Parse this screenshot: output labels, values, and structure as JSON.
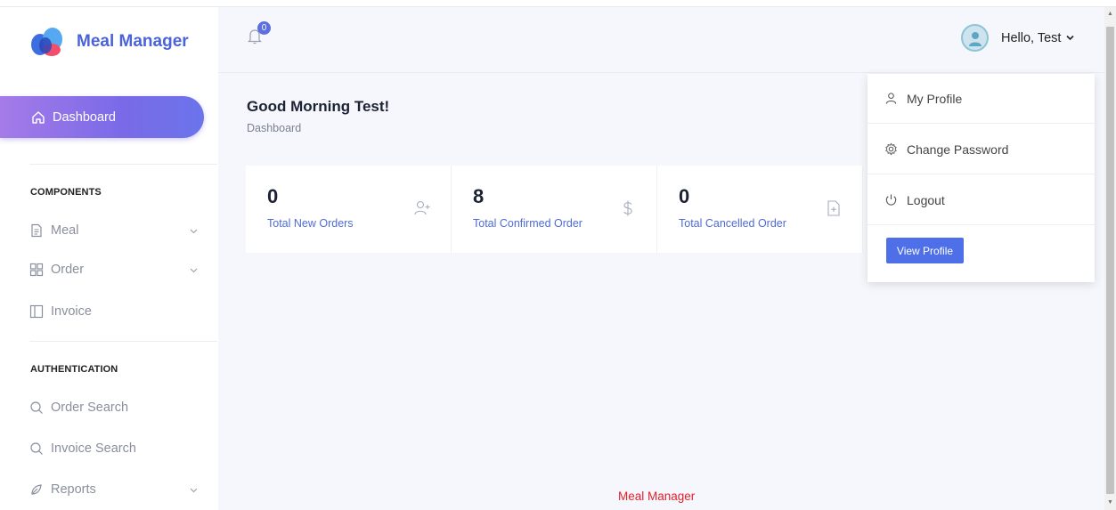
{
  "app": {
    "name": "Meal Manager"
  },
  "sidebar": {
    "active_item": "Dashboard",
    "section_components": "COMPONENTS",
    "components": [
      {
        "label": "Meal",
        "icon": "document-icon",
        "expandable": true
      },
      {
        "label": "Order",
        "icon": "grid-icon",
        "expandable": true
      },
      {
        "label": "Invoice",
        "icon": "panel-icon",
        "expandable": false
      }
    ],
    "section_auth": "AUTHENTICATION",
    "auth": [
      {
        "label": "Order Search",
        "icon": "search-icon",
        "expandable": false
      },
      {
        "label": "Invoice Search",
        "icon": "search-icon",
        "expandable": false
      },
      {
        "label": "Reports",
        "icon": "pen-icon",
        "expandable": true
      }
    ]
  },
  "header": {
    "notification_count": "0",
    "user_greeting": "Hello, Test"
  },
  "page": {
    "greeting": "Good Morning Test!",
    "breadcrumb": "Dashboard"
  },
  "stats": [
    {
      "value": "0",
      "label": "Total New Orders",
      "icon": "add-user-icon"
    },
    {
      "value": "8",
      "label": "Total Confirmed Order",
      "icon": "dollar-icon"
    },
    {
      "value": "0",
      "label": "Total Cancelled Order",
      "icon": "file-plus-icon"
    }
  ],
  "dropdown": {
    "items": [
      {
        "label": "My Profile",
        "icon": "user-icon"
      },
      {
        "label": "Change Password",
        "icon": "gear-icon"
      },
      {
        "label": "Logout",
        "icon": "power-icon"
      }
    ],
    "button": "View Profile"
  },
  "footer": {
    "text": "Meal Manager"
  },
  "colors": {
    "accent": "#4f6fe8",
    "active_gradient_start": "#a57be8",
    "active_gradient_end": "#6b74ea",
    "footer": "#e3202b"
  }
}
